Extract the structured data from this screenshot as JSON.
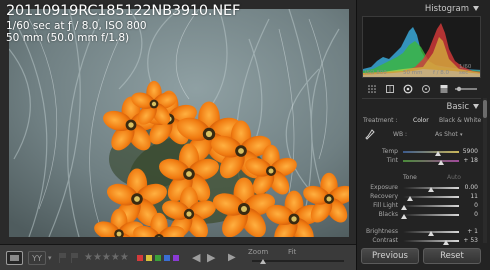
{
  "photo": {
    "filename": "20110919RC185122NB3910.NEF",
    "exposure_line": "1/60 sec at ƒ / 8.0, ISO 800",
    "lens_line": "50 mm (50.0 mm f/1.8)"
  },
  "toolbar": {
    "yy_label": "YY",
    "dropdown": "▾",
    "stars": "★★★★★",
    "prev_arrow": "◀",
    "next_arrow": "▶",
    "play": "▶",
    "zoom_label": "Zoom",
    "fit_label": "Fit",
    "zoom_level": 0.12,
    "label_colors": [
      "#d43a3a",
      "#d9c23a",
      "#3aa03a",
      "#3a6ed4",
      "#8a3ad4"
    ]
  },
  "histogram": {
    "title": "Histogram",
    "iso": "ISO 800",
    "focal": "50 mm",
    "aperture": "f / 8.0",
    "shutter": "1/60 sec"
  },
  "basic": {
    "title": "Basic",
    "treatment_label": "Treatment :",
    "color_label": "Color",
    "bw_label": "Black & White",
    "wb_label": "WB :",
    "wb_value": "As Shot",
    "temp_label": "Temp",
    "temp_value": "5900",
    "temp_pos": 0.62,
    "tint_label": "Tint",
    "tint_value": "+ 18",
    "tint_pos": 0.68,
    "tone_label": "Tone",
    "auto_label": "Auto",
    "exposure_label": "Exposure",
    "exposure_value": "0.00",
    "exposure_pos": 0.5,
    "recovery_label": "Recovery",
    "recovery_value": "11",
    "recovery_pos": 0.12,
    "filllight_label": "Fill Light",
    "filllight_value": "0",
    "filllight_pos": 0.02,
    "blacks_label": "Blacks",
    "blacks_value": "0",
    "blacks_pos": 0.02,
    "brightness_label": "Brightness",
    "brightness_value": "+ 1",
    "brightness_pos": 0.5,
    "contrast_label": "Contrast",
    "contrast_value": "+ 53",
    "contrast_pos": 0.76
  },
  "buttons": {
    "previous": "Previous",
    "reset": "Reset"
  },
  "colors": {
    "panel_bg": "#232323",
    "toolbar_bg": "#3a3a3a"
  }
}
